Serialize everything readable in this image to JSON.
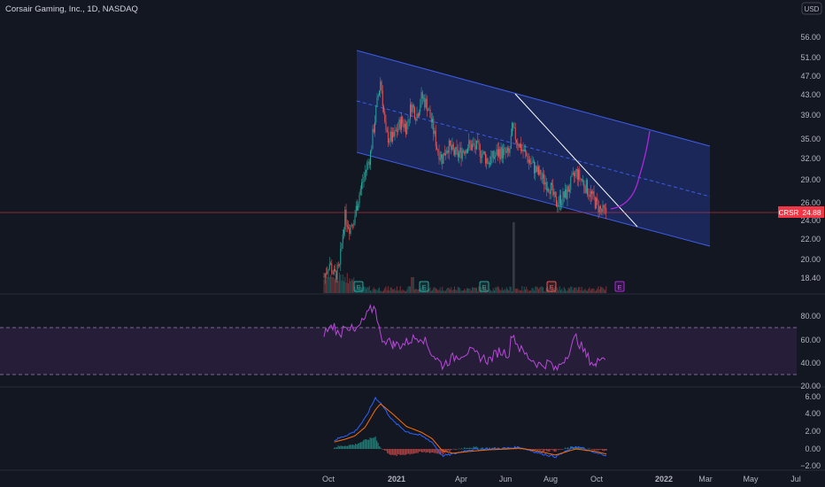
{
  "header": {
    "title": "Corsair Gaming, Inc., 1D, NASDAQ",
    "currency": "USD"
  },
  "price_axis": {
    "ticks": [
      "56.00",
      "51.00",
      "47.00",
      "43.00",
      "39.00",
      "35.00",
      "32.00",
      "29.00",
      "26.00",
      "24.00",
      "22.00",
      "20.00",
      "18.40"
    ],
    "ticker_label": "CRSR",
    "last_price": "24.88"
  },
  "rsi_axis": {
    "ticks": [
      "80.00",
      "60.00",
      "40.00",
      "20.00"
    ]
  },
  "macd_axis": {
    "ticks": [
      "6.00",
      "4.00",
      "2.00",
      "0.00",
      "−2.00"
    ]
  },
  "time_axis": {
    "labels": [
      "Oct",
      "2021",
      "Apr",
      "Jun",
      "Aug",
      "Oct",
      "2022",
      "Mar",
      "May",
      "Jul"
    ]
  },
  "event_markers": [
    {
      "label": "E",
      "type": "earnings"
    },
    {
      "label": "E",
      "type": "earnings"
    },
    {
      "label": "E",
      "type": "earnings"
    },
    {
      "label": "E",
      "type": "earnings-miss"
    },
    {
      "label": "E",
      "type": "earnings-upcoming"
    }
  ],
  "colors": {
    "background": "#131722",
    "up": "#26a69a",
    "down": "#ef5350",
    "channel_fill": "#1e2d6b",
    "channel_line": "#3d5ce8",
    "trendline": "#ffffff",
    "projection": "#b026d9",
    "rsi_line": "#b848d8",
    "rsi_band": "#2a1e3d",
    "macd_line": "#2962ff",
    "signal_line": "#ff6d00",
    "price_line": "#f23645"
  },
  "chart_data": [
    {
      "type": "candlestick",
      "title": "Corsair Gaming, Inc., 1D, NASDAQ",
      "ylabel": "USD",
      "ylim": [
        18.4,
        56
      ],
      "scale": "log",
      "last_price": 24.88,
      "x_range": [
        "2020-09",
        "2022-07"
      ],
      "annotations": [
        "descending channel",
        "descending trendline",
        "projection curve"
      ],
      "close_path": [
        {
          "x": "2020-09-25",
          "y": 18.5
        },
        {
          "x": "2020-10-02",
          "y": 19.8
        },
        {
          "x": "2020-10-09",
          "y": 18.6
        },
        {
          "x": "2020-10-16",
          "y": 19.2
        },
        {
          "x": "2020-10-23",
          "y": 24.5
        },
        {
          "x": "2020-10-30",
          "y": 23.3
        },
        {
          "x": "2020-11-06",
          "y": 24.6
        },
        {
          "x": "2020-11-13",
          "y": 27.5
        },
        {
          "x": "2020-11-20",
          "y": 30.0
        },
        {
          "x": "2020-11-27",
          "y": 32.5
        },
        {
          "x": "2020-12-04",
          "y": 39.0
        },
        {
          "x": "2020-12-11",
          "y": 46.0
        },
        {
          "x": "2020-12-18",
          "y": 35.5
        },
        {
          "x": "2020-12-28",
          "y": 35.0
        },
        {
          "x": "2021-01-08",
          "y": 38.0
        },
        {
          "x": "2021-01-15",
          "y": 37.0
        },
        {
          "x": "2021-01-22",
          "y": 41.0
        },
        {
          "x": "2021-01-29",
          "y": 39.0
        },
        {
          "x": "2021-02-05",
          "y": 42.5
        },
        {
          "x": "2021-02-12",
          "y": 41.0
        },
        {
          "x": "2021-02-19",
          "y": 37.5
        },
        {
          "x": "2021-02-26",
          "y": 33.5
        },
        {
          "x": "2021-03-05",
          "y": 32.0
        },
        {
          "x": "2021-03-12",
          "y": 34.0
        },
        {
          "x": "2021-03-19",
          "y": 33.0
        },
        {
          "x": "2021-03-26",
          "y": 32.5
        },
        {
          "x": "2021-04-09",
          "y": 34.0
        },
        {
          "x": "2021-04-23",
          "y": 33.5
        },
        {
          "x": "2021-05-07",
          "y": 31.5
        },
        {
          "x": "2021-05-21",
          "y": 33.0
        },
        {
          "x": "2021-06-04",
          "y": 32.5
        },
        {
          "x": "2021-06-08",
          "y": 36.5
        },
        {
          "x": "2021-06-18",
          "y": 34.0
        },
        {
          "x": "2021-07-02",
          "y": 31.5
        },
        {
          "x": "2021-07-16",
          "y": 29.5
        },
        {
          "x": "2021-07-30",
          "y": 28.0
        },
        {
          "x": "2021-08-06",
          "y": 26.0
        },
        {
          "x": "2021-08-20",
          "y": 27.0
        },
        {
          "x": "2021-09-03",
          "y": 30.0
        },
        {
          "x": "2021-09-17",
          "y": 28.0
        },
        {
          "x": "2021-09-30",
          "y": 26.0
        },
        {
          "x": "2021-10-08",
          "y": 25.0
        },
        {
          "x": "2021-10-15",
          "y": 24.88
        }
      ]
    },
    {
      "type": "line",
      "title": "RSI",
      "ylim": [
        20,
        90
      ],
      "bands": [
        30,
        70
      ],
      "series": [
        {
          "values": [
            {
              "x": "2020-09-25",
              "y": 66
            },
            {
              "x": "2020-10-09",
              "y": 72
            },
            {
              "x": "2020-10-16",
              "y": 62
            },
            {
              "x": "2020-10-23",
              "y": 74
            },
            {
              "x": "2020-11-06",
              "y": 66
            },
            {
              "x": "2020-11-20",
              "y": 78
            },
            {
              "x": "2020-11-27",
              "y": 85
            },
            {
              "x": "2020-12-04",
              "y": 88
            },
            {
              "x": "2020-12-11",
              "y": 62
            },
            {
              "x": "2020-12-28",
              "y": 56
            },
            {
              "x": "2021-01-08",
              "y": 55
            },
            {
              "x": "2021-01-22",
              "y": 60
            },
            {
              "x": "2021-02-05",
              "y": 63
            },
            {
              "x": "2021-02-19",
              "y": 48
            },
            {
              "x": "2021-03-05",
              "y": 38
            },
            {
              "x": "2021-03-19",
              "y": 44
            },
            {
              "x": "2021-04-09",
              "y": 50
            },
            {
              "x": "2021-05-07",
              "y": 42
            },
            {
              "x": "2021-05-21",
              "y": 50
            },
            {
              "x": "2021-06-04",
              "y": 48
            },
            {
              "x": "2021-06-08",
              "y": 66
            },
            {
              "x": "2021-06-18",
              "y": 52
            },
            {
              "x": "2021-07-02",
              "y": 44
            },
            {
              "x": "2021-07-16",
              "y": 38
            },
            {
              "x": "2021-07-30",
              "y": 40
            },
            {
              "x": "2021-08-06",
              "y": 33
            },
            {
              "x": "2021-08-20",
              "y": 45
            },
            {
              "x": "2021-09-03",
              "y": 62
            },
            {
              "x": "2021-09-17",
              "y": 46
            },
            {
              "x": "2021-09-30",
              "y": 37
            },
            {
              "x": "2021-10-08",
              "y": 48
            },
            {
              "x": "2021-10-15",
              "y": 40
            }
          ]
        }
      ]
    },
    {
      "type": "line",
      "title": "MACD",
      "ylim": [
        -3,
        6.5
      ],
      "series": [
        {
          "values": [
            {
              "x": "2020-10-09",
              "y": 1.0
            },
            {
              "x": "2020-10-23",
              "y": 1.5
            },
            {
              "x": "2020-11-06",
              "y": 2.0
            },
            {
              "x": "2020-11-20",
              "y": 3.5
            },
            {
              "x": "2020-12-04",
              "y": 5.9
            },
            {
              "x": "2020-12-11",
              "y": 5.3
            },
            {
              "x": "2020-12-28",
              "y": 3.2
            },
            {
              "x": "2021-01-15",
              "y": 2.0
            },
            {
              "x": "2021-02-05",
              "y": 1.5
            },
            {
              "x": "2021-02-19",
              "y": 0.8
            },
            {
              "x": "2021-03-05",
              "y": -0.8
            },
            {
              "x": "2021-03-19",
              "y": -0.6
            },
            {
              "x": "2021-04-09",
              "y": -0.1
            },
            {
              "x": "2021-05-07",
              "y": 0.0
            },
            {
              "x": "2021-06-04",
              "y": 0.1
            },
            {
              "x": "2021-06-18",
              "y": 0.2
            },
            {
              "x": "2021-07-16",
              "y": -0.5
            },
            {
              "x": "2021-08-06",
              "y": -0.9
            },
            {
              "x": "2021-09-03",
              "y": 0.3
            },
            {
              "x": "2021-09-30",
              "y": -0.5
            },
            {
              "x": "2021-10-15",
              "y": -0.7
            }
          ]
        },
        {
          "values": [
            {
              "x": "2020-10-09",
              "y": 0.8
            },
            {
              "x": "2020-10-23",
              "y": 1.1
            },
            {
              "x": "2020-11-06",
              "y": 1.5
            },
            {
              "x": "2020-11-20",
              "y": 2.5
            },
            {
              "x": "2020-12-04",
              "y": 4.5
            },
            {
              "x": "2020-12-11",
              "y": 5.2
            },
            {
              "x": "2020-12-28",
              "y": 4.0
            },
            {
              "x": "2021-01-15",
              "y": 2.6
            },
            {
              "x": "2021-02-05",
              "y": 1.9
            },
            {
              "x": "2021-02-19",
              "y": 1.2
            },
            {
              "x": "2021-03-05",
              "y": -0.2
            },
            {
              "x": "2021-03-19",
              "y": -0.5
            },
            {
              "x": "2021-04-09",
              "y": -0.3
            },
            {
              "x": "2021-05-07",
              "y": -0.1
            },
            {
              "x": "2021-06-04",
              "y": 0.0
            },
            {
              "x": "2021-06-18",
              "y": 0.1
            },
            {
              "x": "2021-07-16",
              "y": -0.3
            },
            {
              "x": "2021-08-06",
              "y": -0.7
            },
            {
              "x": "2021-09-03",
              "y": 0.0
            },
            {
              "x": "2021-09-30",
              "y": -0.3
            },
            {
              "x": "2021-10-15",
              "y": -0.6
            }
          ]
        }
      ]
    }
  ]
}
